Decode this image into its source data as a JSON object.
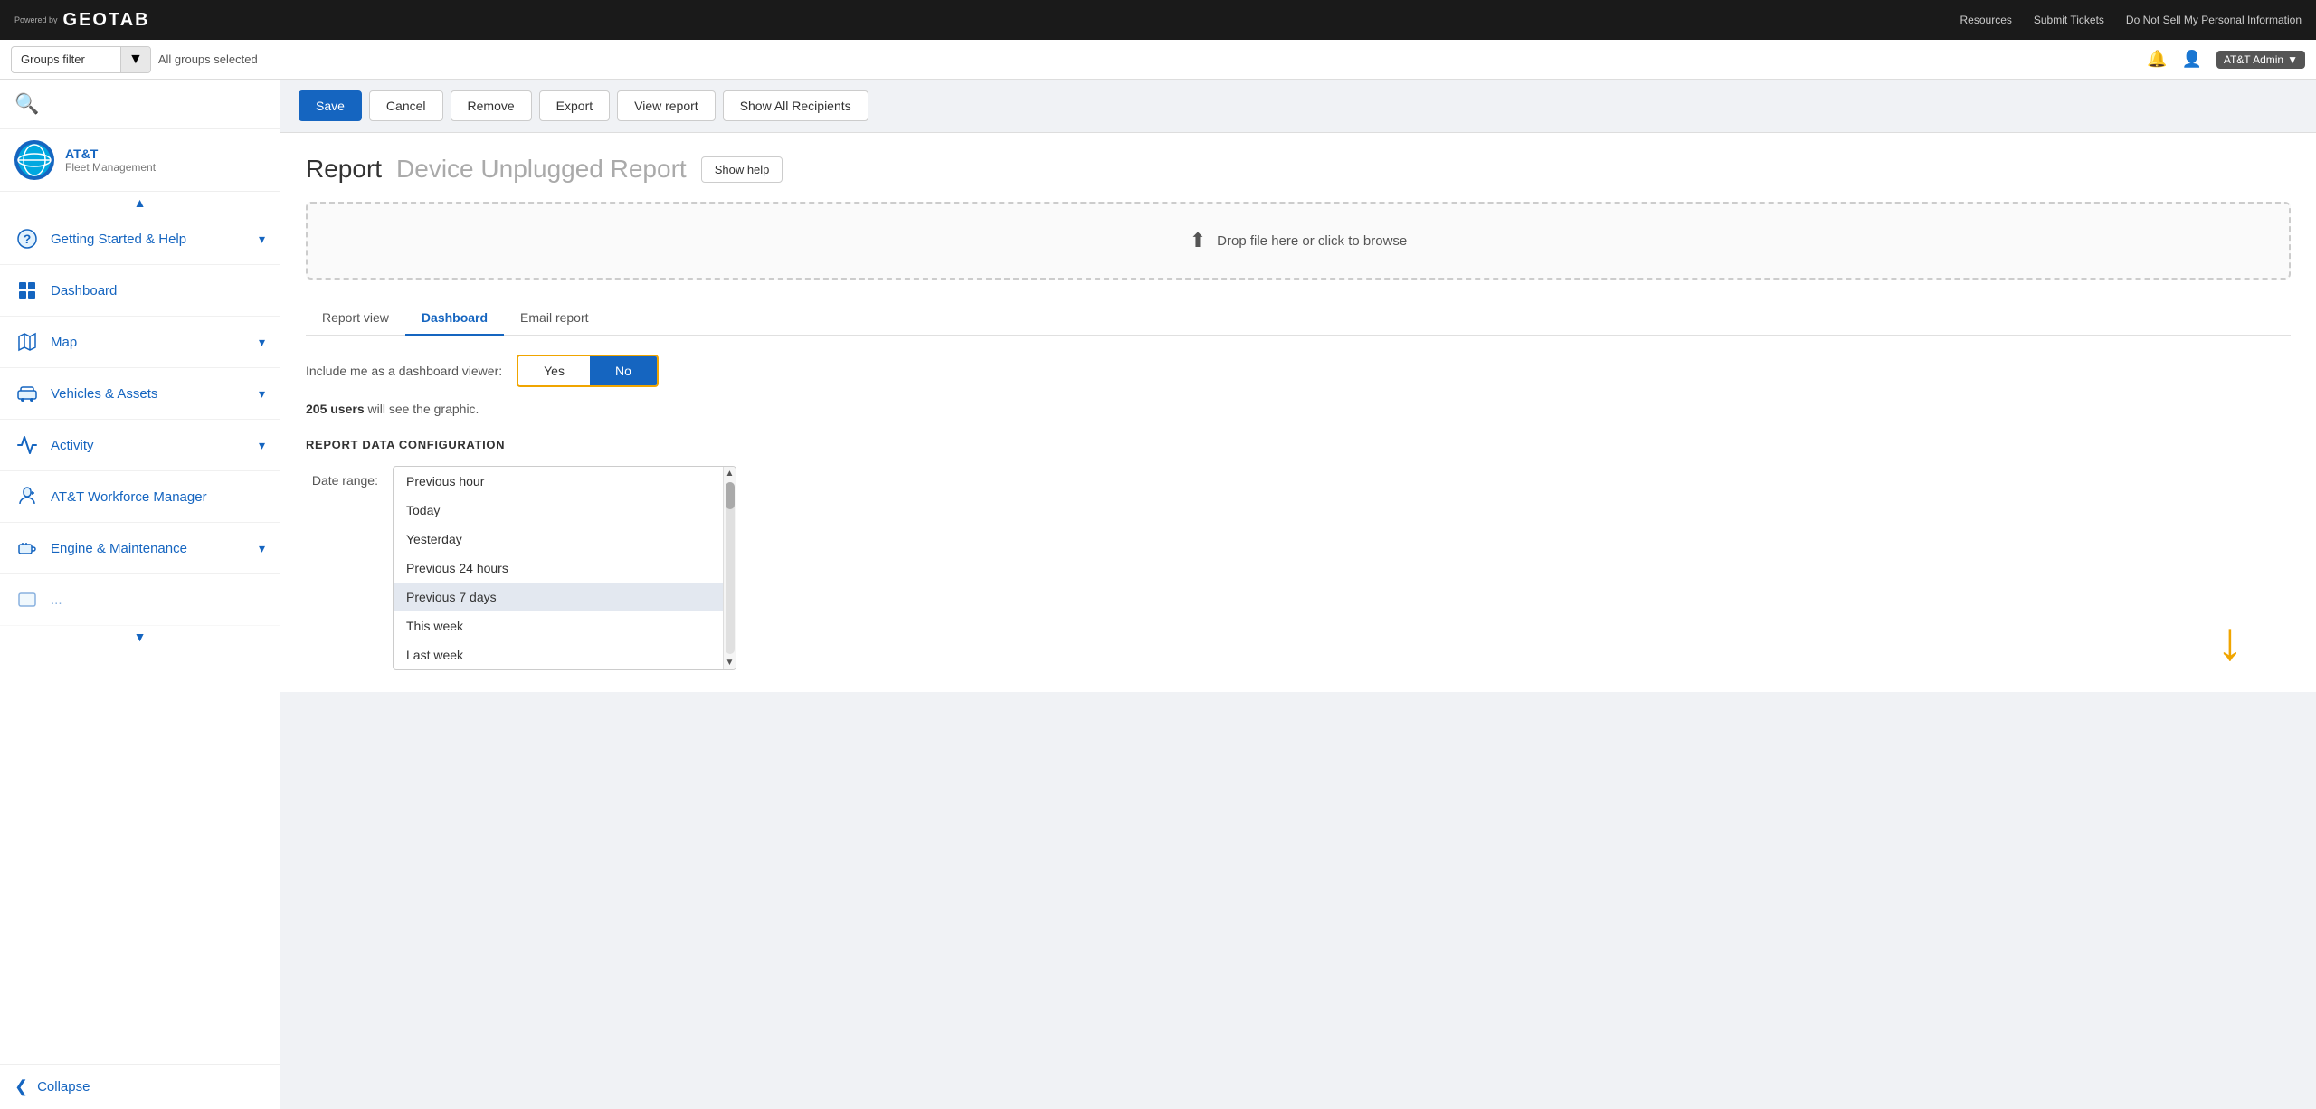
{
  "topNav": {
    "poweredBy": "Powered by",
    "brand": "GEOTAB",
    "links": [
      "Resources",
      "Submit Tickets",
      "Do Not Sell My Personal Information"
    ],
    "userLabel": "AT&T Admin"
  },
  "groupsBar": {
    "filterLabel": "Groups filter",
    "allGroupsLabel": "All groups selected"
  },
  "sidebar": {
    "orgName": "AT&T",
    "orgSub": "Fleet Management",
    "items": [
      {
        "label": "Getting Started & Help",
        "icon": "?"
      },
      {
        "label": "Dashboard",
        "icon": "📊"
      },
      {
        "label": "Map",
        "icon": "🗺"
      },
      {
        "label": "Vehicles & Assets",
        "icon": "🚛"
      },
      {
        "label": "Activity",
        "icon": "📈"
      },
      {
        "label": "AT&T Workforce Manager",
        "icon": "🧩"
      },
      {
        "label": "Engine & Maintenance",
        "icon": "🎬"
      }
    ],
    "collapseLabel": "Collapse"
  },
  "toolbar": {
    "saveLabel": "Save",
    "cancelLabel": "Cancel",
    "removeLabel": "Remove",
    "exportLabel": "Export",
    "viewReportLabel": "View report",
    "showAllRecipientsLabel": "Show All Recipients"
  },
  "page": {
    "titlePrefix": "Report",
    "titleName": "Device Unplugged Report",
    "showHelpLabel": "Show help",
    "dropZoneText": "Drop file here or click to browse",
    "tabs": [
      "Report view",
      "Dashboard",
      "Email report"
    ],
    "activeTab": "Dashboard",
    "viewerLabel": "Include me as a dashboard viewer:",
    "yesLabel": "Yes",
    "noLabel": "No",
    "usersCount": "205 users",
    "usersText": " will see the graphic.",
    "sectionHeading": "REPORT DATA CONFIGURATION",
    "dateRangeLabel": "Date range:",
    "dateOptions": [
      "Previous hour",
      "Today",
      "Yesterday",
      "Previous 24 hours",
      "Previous 7 days",
      "This week",
      "Last week"
    ],
    "selectedDateOption": "Previous 7 days"
  }
}
